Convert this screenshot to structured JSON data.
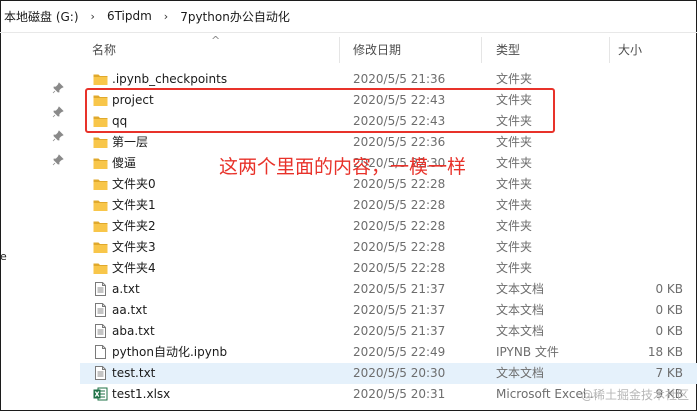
{
  "breadcrumb": [
    "本地磁盘 (G:)",
    "6Tipdm",
    "7python办公自动化"
  ],
  "breadcrumb_separator": "›",
  "left_edge_char": "e",
  "columns": {
    "name": "名称",
    "date": "修改日期",
    "type": "类型",
    "size": "大小"
  },
  "files": [
    {
      "name": ".ipynb_checkpoints",
      "date": "2020/5/5 21:36",
      "type": "文件夹",
      "size": "",
      "icon": "folder-icon"
    },
    {
      "name": "project",
      "date": "2020/5/5 22:43",
      "type": "文件夹",
      "size": "",
      "icon": "folder-icon"
    },
    {
      "name": "qq",
      "date": "2020/5/5 22:43",
      "type": "文件夹",
      "size": "",
      "icon": "folder-icon"
    },
    {
      "name": "第一层",
      "date": "2020/5/5 22:36",
      "type": "文件夹",
      "size": "",
      "icon": "folder-icon"
    },
    {
      "name": "傻逼",
      "date": "2020/5/5 22:30",
      "type": "文件夹",
      "size": "",
      "icon": "folder-icon"
    },
    {
      "name": "文件夹0",
      "date": "2020/5/5 22:28",
      "type": "文件夹",
      "size": "",
      "icon": "folder-icon"
    },
    {
      "name": "文件夹1",
      "date": "2020/5/5 22:28",
      "type": "文件夹",
      "size": "",
      "icon": "folder-icon"
    },
    {
      "name": "文件夹2",
      "date": "2020/5/5 22:28",
      "type": "文件夹",
      "size": "",
      "icon": "folder-icon"
    },
    {
      "name": "文件夹3",
      "date": "2020/5/5 22:28",
      "type": "文件夹",
      "size": "",
      "icon": "folder-icon"
    },
    {
      "name": "文件夹4",
      "date": "2020/5/5 22:28",
      "type": "文件夹",
      "size": "",
      "icon": "folder-icon"
    },
    {
      "name": "a.txt",
      "date": "2020/5/5 21:37",
      "type": "文本文档",
      "size": "0 KB",
      "icon": "text-file-icon"
    },
    {
      "name": "aa.txt",
      "date": "2020/5/5 21:37",
      "type": "文本文档",
      "size": "0 KB",
      "icon": "text-file-icon"
    },
    {
      "name": "aba.txt",
      "date": "2020/5/5 21:37",
      "type": "文本文档",
      "size": "0 KB",
      "icon": "text-file-icon"
    },
    {
      "name": "python自动化.ipynb",
      "date": "2020/5/5 22:49",
      "type": "IPYNB 文件",
      "size": "18 KB",
      "icon": "generic-file-icon"
    },
    {
      "name": "test.txt",
      "date": "2020/5/5 20:30",
      "type": "文本文档",
      "size": "7 KB",
      "icon": "text-file-icon",
      "selected": true
    },
    {
      "name": "test1.xlsx",
      "date": "2020/5/5 20:31",
      "type": "Microsoft Excel...",
      "size": "9 KB",
      "icon": "excel-file-icon"
    }
  ],
  "annotation": "这两个里面的内容，一模一样",
  "watermark": "@稀土掘金技术社区",
  "colors": {
    "annotation": "#e8322a",
    "folder": "#f5c242",
    "selected_row": "#e5f1fb",
    "excel": "#1e7145"
  }
}
